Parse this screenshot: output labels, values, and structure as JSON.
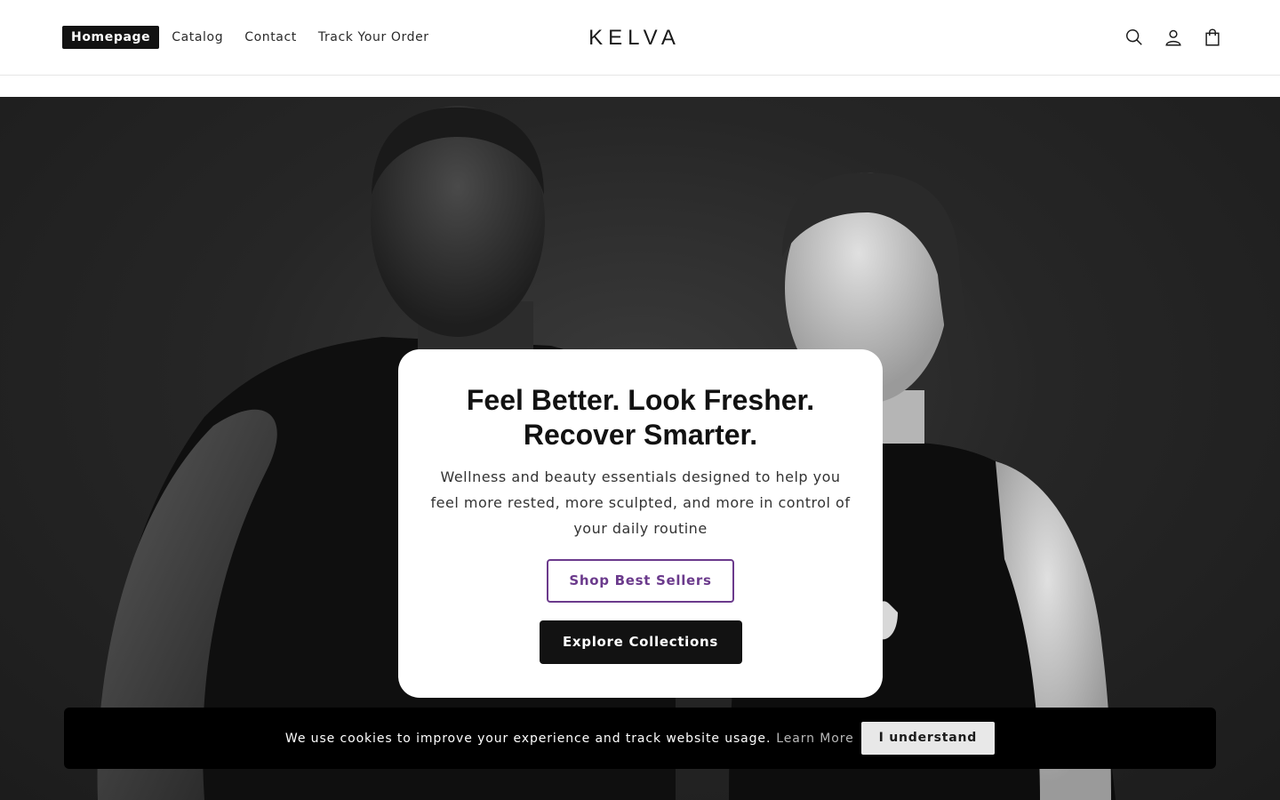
{
  "header": {
    "nav": [
      {
        "label": "Homepage",
        "active": true
      },
      {
        "label": "Catalog",
        "active": false
      },
      {
        "label": "Contact",
        "active": false
      },
      {
        "label": "Track Your Order",
        "active": false
      }
    ],
    "logo": "KELVA",
    "icons": [
      "search-icon",
      "account-icon",
      "cart-icon"
    ]
  },
  "hero": {
    "image": "black-and-white photo of a man and a woman",
    "title_line1": "Feel Better. Look Fresher.",
    "title_line2": "Recover Smarter.",
    "subtitle": "Wellness and beauty essentials designed to help you feel more rested, more sculpted, and more in control of your daily routine",
    "primary_button": "Shop Best Sellers",
    "secondary_button": "Explore Collections"
  },
  "cookie_banner": {
    "text": "We use cookies to improve your experience and track website usage.",
    "link": "Learn More",
    "button": "I understand"
  },
  "colors": {
    "accent_purple": "#6b3a8c",
    "dark": "#121212",
    "banner_bg": "#000000"
  }
}
